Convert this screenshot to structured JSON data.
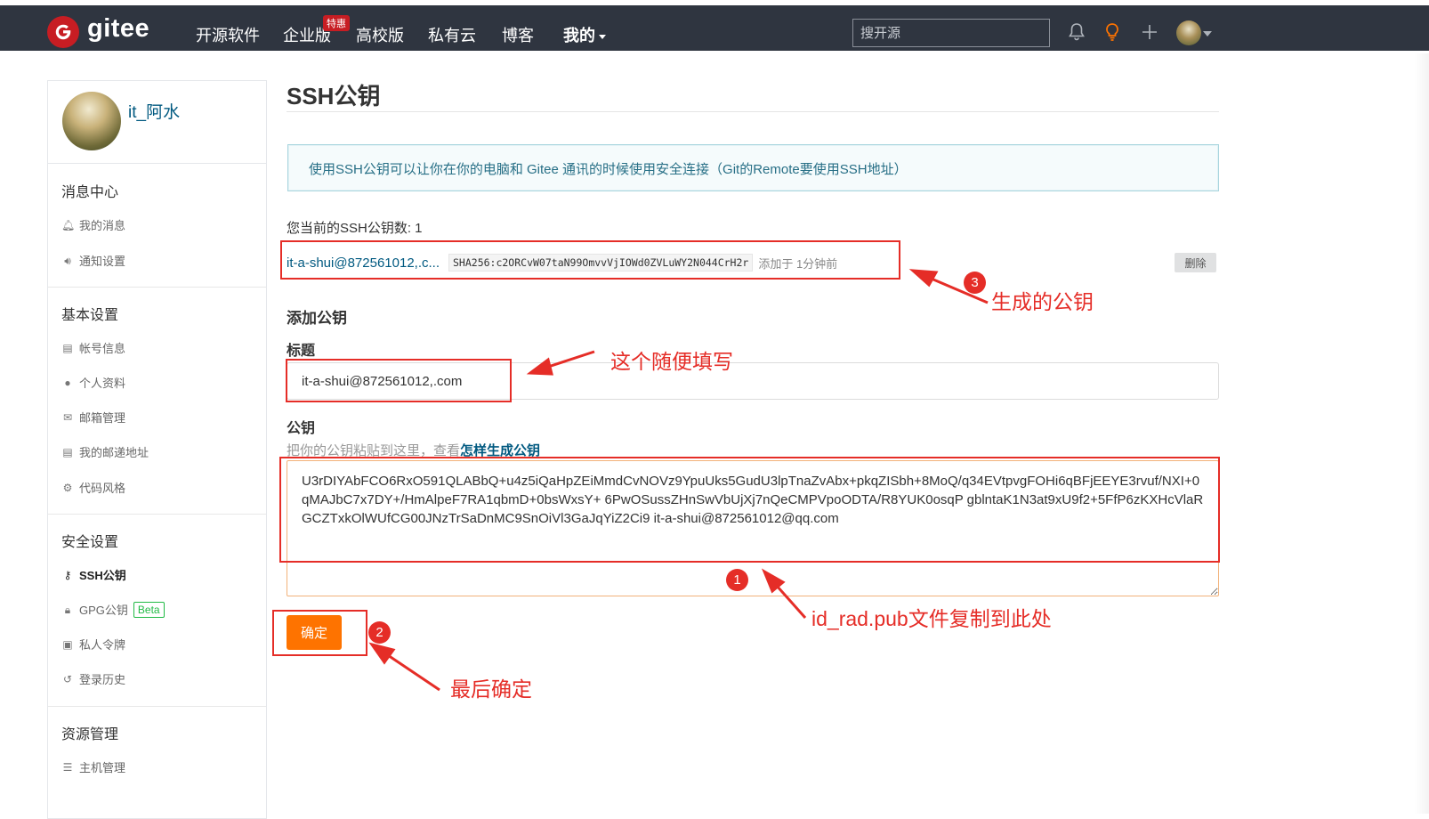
{
  "nav": {
    "brand": "gitee",
    "items": [
      "开源软件",
      "企业版",
      "高校版",
      "私有云",
      "博客",
      "我的"
    ],
    "hot_badge": "特惠",
    "search_placeholder": "搜开源"
  },
  "sidebar": {
    "username": "it_阿水",
    "groups": {
      "messages": "消息中心",
      "basic": "基本设置",
      "security": "安全设置",
      "resources": "资源管理"
    },
    "items": {
      "my_messages": "我的消息",
      "notify_settings": "通知设置",
      "account_info": "帐号信息",
      "profile": "个人资料",
      "email_manage": "邮箱管理",
      "commit_email": "我的邮递地址",
      "code_style": "代码风格",
      "ssh_keys": "SSH公钥",
      "gpg_keys": "GPG公钥",
      "gpg_beta": "Beta",
      "private_tokens": "私人令牌",
      "login_history": "登录历史",
      "host_manage": "主机管理"
    }
  },
  "main": {
    "title": "SSH公钥",
    "info": "使用SSH公钥可以让你在你的电脑和 Gitee 通讯的时候使用安全连接（Git的Remote要使用SSH地址）",
    "key_count": "您当前的SSH公钥数: 1",
    "key": {
      "title": "it-a-shui@872561012,.c...",
      "fingerprint": "SHA256:c2ORCvW07taN99OmvvVjIOWd0ZVLuWY2N044CrH2r",
      "added": "添加于 1分钟前",
      "delete": "删除"
    },
    "add_heading": "添加公钥",
    "title_label": "标题",
    "title_value": "it-a-shui@872561012,.com",
    "pubkey_label": "公钥",
    "pubkey_hint": "把你的公钥粘贴到这里，查看",
    "pubkey_hint_link": "怎样生成公钥",
    "pubkey_value": "U3rDIYAbFCO6RxO591QLABbQ+u4z5iQaHpZEiMmdCvNOVz9YpuUks5GudU3lpTnaZvAbx+pkqZISbh+8MoQ/q34EVtpvgFOHi6qBFjEEYE3rvuf/NXI+0qMAJbC7x7DY+/HmAlpeF7RA1qbmD+0bsWxsY+ 6PwOSussZHnSwVbUjXj7nQeCMPVpoODTA/R8YUK0osqP gblntaK1N3at9xU9f2+5FfP6zKXHcVlaRGCZTxkOlWUfCG00JNzTrSaDnMC9SnOiVl3GaJqYiZ2Ci9 it-a-shui@872561012@qq.com",
    "confirm": "确定"
  },
  "annotations": {
    "generated_key": "生成的公钥",
    "title_fill": "这个随便填写",
    "copy_pub": "id_rad.pub文件复制到此处",
    "final_confirm": "最后确定",
    "num1": "1",
    "num2": "2",
    "num3": "3",
    "color": "#e52d27"
  },
  "colors": {
    "navbar": "#2f3540",
    "logo_red": "#c71d23",
    "link_blue": "#005980",
    "confirm_orange": "#fe7300"
  }
}
